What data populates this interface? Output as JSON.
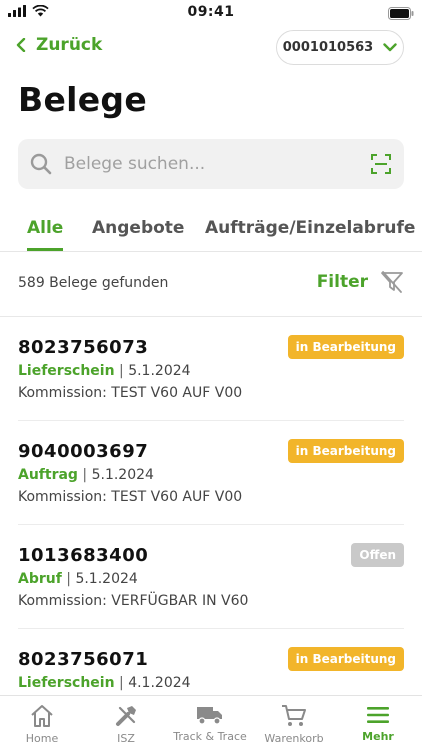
{
  "status_bar": {
    "time": "09:41"
  },
  "header": {
    "back_label": "Zurück",
    "account_number": "0001010563",
    "title": "Belege"
  },
  "search": {
    "placeholder": "Belege suchen..."
  },
  "tabs": [
    {
      "label": "Alle",
      "active": true
    },
    {
      "label": "Angebote",
      "active": false
    },
    {
      "label": "Aufträge/Einzelabrufe",
      "active": false
    }
  ],
  "results": {
    "count_text": "589 Belege gefunden",
    "filter_label": "Filter"
  },
  "documents": [
    {
      "number": "8023756073",
      "type": "Lieferschein",
      "separator": "|",
      "date": "5.1.2024",
      "commission": "Kommission: TEST V60 AUF V00",
      "status": "in Bearbeitung",
      "status_color": "#f2b52a"
    },
    {
      "number": "9040003697",
      "type": "Auftrag",
      "separator": "|",
      "date": "5.1.2024",
      "commission": "Kommission: TEST V60 AUF V00",
      "status": "in Bearbeitung",
      "status_color": "#f2b52a"
    },
    {
      "number": "1013683400",
      "type": "Abruf",
      "separator": "|",
      "date": "5.1.2024",
      "commission": "Kommission: VERFÜGBAR IN V60",
      "status": "Offen",
      "status_color": "#c9c9c9"
    },
    {
      "number": "8023756071",
      "type": "Lieferschein",
      "separator": "|",
      "date": "4.1.2024",
      "commission": "",
      "status": "in Bearbeitung",
      "status_color": "#f2b52a"
    }
  ],
  "bottom_nav": [
    {
      "label": "Home",
      "icon": "home-icon",
      "active": false
    },
    {
      "label": "ISZ",
      "icon": "tools-icon",
      "active": false
    },
    {
      "label": "Track & Trace",
      "icon": "truck-icon",
      "active": false
    },
    {
      "label": "Warenkorb",
      "icon": "cart-icon",
      "active": false
    },
    {
      "label": "Mehr",
      "icon": "menu-icon",
      "active": true
    }
  ],
  "colors": {
    "accent": "#4ca32b",
    "badge_processing": "#f2b52a",
    "badge_open": "#c9c9c9"
  }
}
